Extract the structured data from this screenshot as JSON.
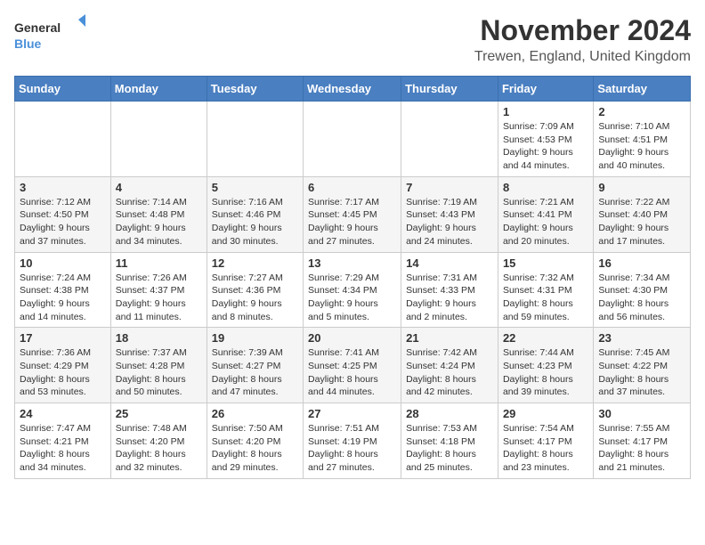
{
  "logo": {
    "line1": "General",
    "line2": "Blue"
  },
  "title": "November 2024",
  "location": "Trewen, England, United Kingdom",
  "weekdays": [
    "Sunday",
    "Monday",
    "Tuesday",
    "Wednesday",
    "Thursday",
    "Friday",
    "Saturday"
  ],
  "weeks": [
    [
      {
        "day": "",
        "info": ""
      },
      {
        "day": "",
        "info": ""
      },
      {
        "day": "",
        "info": ""
      },
      {
        "day": "",
        "info": ""
      },
      {
        "day": "",
        "info": ""
      },
      {
        "day": "1",
        "info": "Sunrise: 7:09 AM\nSunset: 4:53 PM\nDaylight: 9 hours and 44 minutes."
      },
      {
        "day": "2",
        "info": "Sunrise: 7:10 AM\nSunset: 4:51 PM\nDaylight: 9 hours and 40 minutes."
      }
    ],
    [
      {
        "day": "3",
        "info": "Sunrise: 7:12 AM\nSunset: 4:50 PM\nDaylight: 9 hours and 37 minutes."
      },
      {
        "day": "4",
        "info": "Sunrise: 7:14 AM\nSunset: 4:48 PM\nDaylight: 9 hours and 34 minutes."
      },
      {
        "day": "5",
        "info": "Sunrise: 7:16 AM\nSunset: 4:46 PM\nDaylight: 9 hours and 30 minutes."
      },
      {
        "day": "6",
        "info": "Sunrise: 7:17 AM\nSunset: 4:45 PM\nDaylight: 9 hours and 27 minutes."
      },
      {
        "day": "7",
        "info": "Sunrise: 7:19 AM\nSunset: 4:43 PM\nDaylight: 9 hours and 24 minutes."
      },
      {
        "day": "8",
        "info": "Sunrise: 7:21 AM\nSunset: 4:41 PM\nDaylight: 9 hours and 20 minutes."
      },
      {
        "day": "9",
        "info": "Sunrise: 7:22 AM\nSunset: 4:40 PM\nDaylight: 9 hours and 17 minutes."
      }
    ],
    [
      {
        "day": "10",
        "info": "Sunrise: 7:24 AM\nSunset: 4:38 PM\nDaylight: 9 hours and 14 minutes."
      },
      {
        "day": "11",
        "info": "Sunrise: 7:26 AM\nSunset: 4:37 PM\nDaylight: 9 hours and 11 minutes."
      },
      {
        "day": "12",
        "info": "Sunrise: 7:27 AM\nSunset: 4:36 PM\nDaylight: 9 hours and 8 minutes."
      },
      {
        "day": "13",
        "info": "Sunrise: 7:29 AM\nSunset: 4:34 PM\nDaylight: 9 hours and 5 minutes."
      },
      {
        "day": "14",
        "info": "Sunrise: 7:31 AM\nSunset: 4:33 PM\nDaylight: 9 hours and 2 minutes."
      },
      {
        "day": "15",
        "info": "Sunrise: 7:32 AM\nSunset: 4:31 PM\nDaylight: 8 hours and 59 minutes."
      },
      {
        "day": "16",
        "info": "Sunrise: 7:34 AM\nSunset: 4:30 PM\nDaylight: 8 hours and 56 minutes."
      }
    ],
    [
      {
        "day": "17",
        "info": "Sunrise: 7:36 AM\nSunset: 4:29 PM\nDaylight: 8 hours and 53 minutes."
      },
      {
        "day": "18",
        "info": "Sunrise: 7:37 AM\nSunset: 4:28 PM\nDaylight: 8 hours and 50 minutes."
      },
      {
        "day": "19",
        "info": "Sunrise: 7:39 AM\nSunset: 4:27 PM\nDaylight: 8 hours and 47 minutes."
      },
      {
        "day": "20",
        "info": "Sunrise: 7:41 AM\nSunset: 4:25 PM\nDaylight: 8 hours and 44 minutes."
      },
      {
        "day": "21",
        "info": "Sunrise: 7:42 AM\nSunset: 4:24 PM\nDaylight: 8 hours and 42 minutes."
      },
      {
        "day": "22",
        "info": "Sunrise: 7:44 AM\nSunset: 4:23 PM\nDaylight: 8 hours and 39 minutes."
      },
      {
        "day": "23",
        "info": "Sunrise: 7:45 AM\nSunset: 4:22 PM\nDaylight: 8 hours and 37 minutes."
      }
    ],
    [
      {
        "day": "24",
        "info": "Sunrise: 7:47 AM\nSunset: 4:21 PM\nDaylight: 8 hours and 34 minutes."
      },
      {
        "day": "25",
        "info": "Sunrise: 7:48 AM\nSunset: 4:20 PM\nDaylight: 8 hours and 32 minutes."
      },
      {
        "day": "26",
        "info": "Sunrise: 7:50 AM\nSunset: 4:20 PM\nDaylight: 8 hours and 29 minutes."
      },
      {
        "day": "27",
        "info": "Sunrise: 7:51 AM\nSunset: 4:19 PM\nDaylight: 8 hours and 27 minutes."
      },
      {
        "day": "28",
        "info": "Sunrise: 7:53 AM\nSunset: 4:18 PM\nDaylight: 8 hours and 25 minutes."
      },
      {
        "day": "29",
        "info": "Sunrise: 7:54 AM\nSunset: 4:17 PM\nDaylight: 8 hours and 23 minutes."
      },
      {
        "day": "30",
        "info": "Sunrise: 7:55 AM\nSunset: 4:17 PM\nDaylight: 8 hours and 21 minutes."
      }
    ]
  ]
}
